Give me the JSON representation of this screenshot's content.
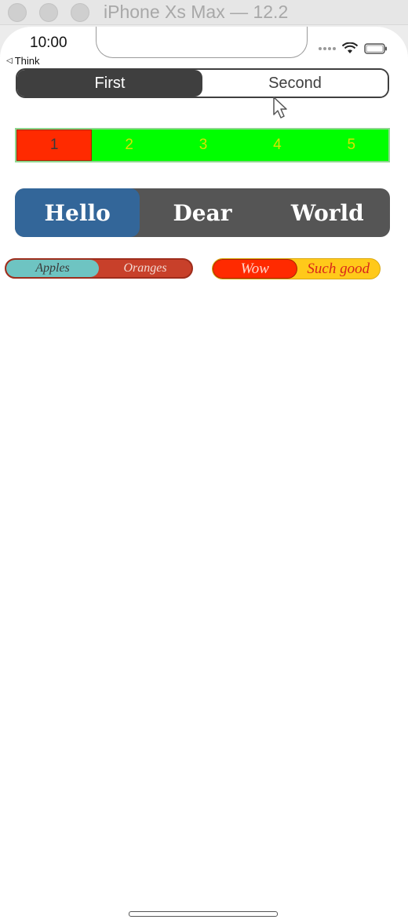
{
  "window": {
    "title": "iPhone Xs Max — 12.2"
  },
  "status_bar": {
    "time": "10:00"
  },
  "nav": {
    "back_label": "Think"
  },
  "segmented_1": {
    "segments": [
      "First",
      "Second"
    ],
    "selected_index": 0,
    "colors": {
      "tint": "#3f3f3f",
      "background": "#ffffff"
    }
  },
  "segmented_2": {
    "segments": [
      "1",
      "2",
      "3",
      "4",
      "5"
    ],
    "selected_index": 0,
    "colors": {
      "background": "#00ff00",
      "selected": "#ff2a00",
      "text": "#d7e300"
    }
  },
  "segmented_3": {
    "segments": [
      "Hello",
      "Dear",
      "World"
    ],
    "selected_index": 0,
    "colors": {
      "background": "#555555",
      "selected": "#336699",
      "text": "#ffffff"
    }
  },
  "segmented_4": {
    "segments": [
      "Apples",
      "Oranges"
    ],
    "selected_index": 0,
    "colors": {
      "background": "#c8402a",
      "selected": "#6ec4c2"
    }
  },
  "segmented_5": {
    "segments": [
      "Wow",
      "Such good"
    ],
    "selected_index": 0,
    "colors": {
      "background": "#ffc91a",
      "selected": "#ff2a00"
    }
  },
  "icons": [
    "wifi-icon",
    "battery-icon",
    "signal-icon",
    "back-arrow-icon",
    "mouse-cursor-icon"
  ]
}
